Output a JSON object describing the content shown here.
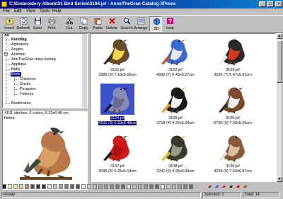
{
  "window": {
    "title": "C:\\Embroidery Album\\31 Bird Series\\3104.jef - AnneTheGran Catalog XPress",
    "min_glyph": "_",
    "max_glyph": "□",
    "close_glyph": "×"
  },
  "menu": [
    "File",
    "Edit",
    "View",
    "Tools",
    "Help"
  ],
  "toolbar": [
    {
      "label": "Insert",
      "icon": "insert-icon"
    },
    {
      "label": "Refresh",
      "icon": "refresh-icon"
    },
    {
      "label": "Save",
      "icon": "save-icon"
    },
    {
      "label": "Print",
      "icon": "print-icon"
    },
    {
      "label": "Cut",
      "icon": "cut-icon"
    },
    {
      "label": "Copy",
      "icon": "copy-icon"
    },
    {
      "label": "Paste",
      "icon": "paste-icon"
    },
    {
      "label": "Delete",
      "icon": "delete-icon"
    },
    {
      "label": "Search",
      "icon": "search-icon"
    },
    {
      "label": "Arrange",
      "icon": "arrange-icon"
    },
    {
      "label": "3D",
      "icon": "3d-icon"
    },
    {
      "label": "Help",
      "icon": "help-icon"
    }
  ],
  "tree": {
    "root": "All",
    "items": [
      "Pending",
      "Alphabets",
      "Angels",
      "Animals",
      "AnnTheGran mina bishag",
      "Applique",
      "Baby",
      "Birds"
    ],
    "children": [
      "Chickens",
      "Ducks",
      "Penguins",
      "Turkeys"
    ],
    "last": "Bookmarks",
    "selected": "Birds"
  },
  "info": {
    "stats": "4101 stitches, 6 colors, 6.23x6.48 cm",
    "notes_label": "Notes:"
  },
  "thumbnails": [
    {
      "name": "3101.jef",
      "stats": "3389 (6) 7.18x6.66cm",
      "colors": {
        "body": "#6a4a2a",
        "belly": "#f0d84a",
        "accent": "#2a2a2a"
      }
    },
    {
      "name": "3102.jef",
      "stats": "4092 (7) 6.43x6.27cm",
      "colors": {
        "body": "#3a6ad0",
        "belly": "#e8e8f0",
        "accent": "#b05a2a"
      }
    },
    {
      "name": "3103.jef",
      "stats": "3036 (7) 5.47x6.91cm",
      "colors": {
        "body": "#2a2a2a",
        "belly": "#d83a1a",
        "accent": "#e8e8e8"
      }
    },
    {
      "name": "3104.jef",
      "stats": "4101 (6) 6.23x6.48cm",
      "colors": {
        "body": "#8a8ab8",
        "belly": "#6a6a90",
        "accent": "#1a1a40"
      }
    },
    {
      "name": "3105.jef",
      "stats": "2718 (4) 4.26x6.29cm",
      "colors": {
        "body": "#1a1a1a",
        "belly": "#f2f2f2",
        "accent": "#e8a020"
      }
    },
    {
      "name": "3106.jef",
      "stats": "5730 (5) 7.50x6.25cm",
      "colors": {
        "body": "#7a4a2a",
        "belly": "#f0f0f0",
        "accent": "#2a2a2a"
      }
    },
    {
      "name": "3107.jef",
      "stats": "3096 (5) 6.25x6.64cm",
      "colors": {
        "body": "#d01818",
        "belly": "#b01010",
        "accent": "#1a1a1a"
      }
    },
    {
      "name": "3108.jef",
      "stats": "2342 (6) 4.25x6.39cm",
      "colors": {
        "body": "#3a3a2a",
        "belly": "#9a9a8a",
        "accent": "#e0c020"
      }
    },
    {
      "name": "3109.jef",
      "stats": "4239 (5) 7.53x6.97cm",
      "colors": {
        "body": "#8a5a3a",
        "belly": "#d8c0a0",
        "accent": "#e8e0d0"
      }
    }
  ],
  "selected_index": 3,
  "palette": [
    "#1a1a1a",
    "#ffffff",
    "#f4f0a0",
    "#d8d0a0",
    "#b09060",
    "#6a4a2a",
    "#3a3a2a",
    "#2a3a2a",
    "#e0e0e0",
    "#c8c8c8",
    "#a0a0a0",
    "#808080",
    "#606060",
    "#505050",
    "#e8e8e8",
    "#d0d0d0",
    "#b8b8b8",
    "#a8a8a8",
    "#989898",
    "#888888",
    "#787878",
    "#686868",
    "#dcdcdc",
    "#c4c4c4",
    "#acacac",
    "#949494",
    "#7c7c7c",
    "#646464",
    "#e4e4e4",
    "#cccccc",
    "#b4b4b4",
    "#9c9c9c",
    "#848484",
    "#6c6c6c"
  ],
  "status": {
    "ready": "Ready",
    "selected": "Selected: 1",
    "total": "Total: 14"
  }
}
